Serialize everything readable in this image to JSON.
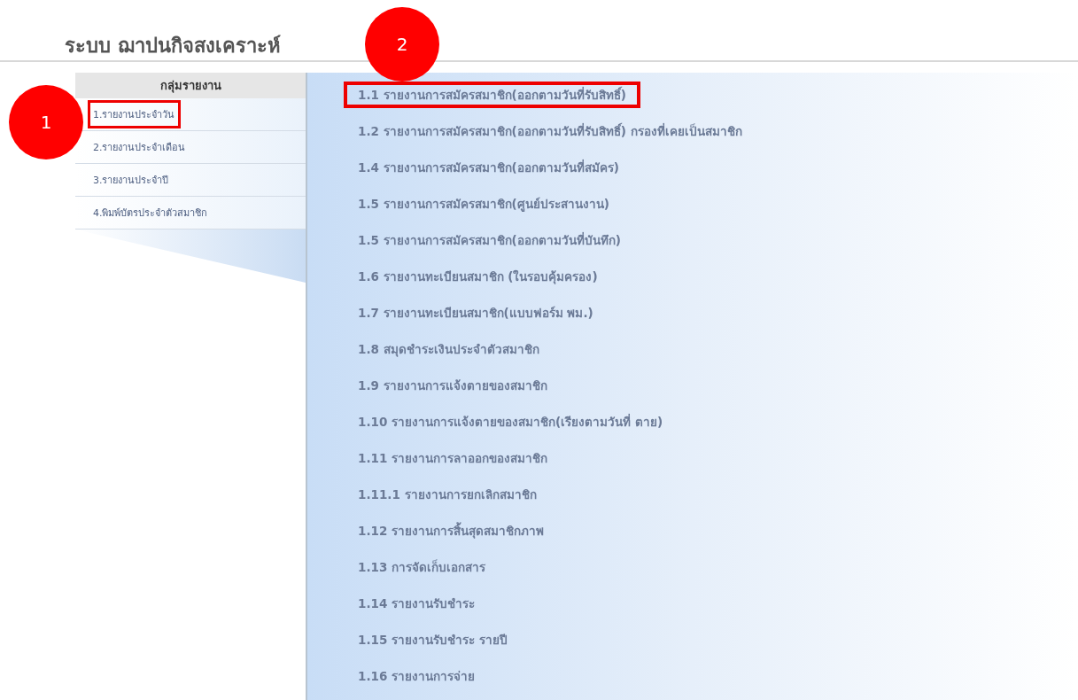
{
  "header": {
    "title": "ระบบ ฌาปนกิจสงเคราะห์"
  },
  "sidebar": {
    "heading": "กลุ่มรายงาน",
    "items": [
      {
        "label": "1.รายงานประจำวัน",
        "annotated": true
      },
      {
        "label": "2.รายงานประจำเดือน",
        "annotated": false
      },
      {
        "label": "3.รายงานประจำปี",
        "annotated": false
      },
      {
        "label": "4.พิมพ์บัตรประจำตัวสมาชิก",
        "annotated": false
      }
    ]
  },
  "reports": [
    {
      "label": "1.1 รายงานการสมัครสมาชิก(ออกตามวันที่รับสิทธิ์)",
      "annotated": true
    },
    {
      "label": "1.2 รายงานการสมัครสมาชิก(ออกตามวันที่รับสิทธิ์) กรองที่เคยเป็นสมาชิก",
      "annotated": false
    },
    {
      "label": "1.4 รายงานการสมัครสมาชิก(ออกตามวันที่สมัคร)",
      "annotated": false
    },
    {
      "label": "1.5 รายงานการสมัครสมาชิก(ศูนย์ประสานงาน)",
      "annotated": false
    },
    {
      "label": "1.5 รายงานการสมัครสมาชิก(ออกตามวันที่บันทึก)",
      "annotated": false
    },
    {
      "label": "1.6 รายงานทะเบียนสมาชิก (ในรอบคุ้มครอง)",
      "annotated": false
    },
    {
      "label": "1.7 รายงานทะเบียนสมาชิก(แบบฟอร์ม พม.)",
      "annotated": false
    },
    {
      "label": "1.8 สมุดชำระเงินประจำตัวสมาชิก",
      "annotated": false
    },
    {
      "label": "1.9 รายงานการแจ้งตายของสมาชิก",
      "annotated": false
    },
    {
      "label": "1.10 รายงานการแจ้งตายของสมาชิก(เรียงตามวันที่ ตาย)",
      "annotated": false
    },
    {
      "label": "1.11 รายงานการลาออกของสมาชิก",
      "annotated": false
    },
    {
      "label": "1.11.1 รายงานการยกเลิกสมาชิก",
      "annotated": false
    },
    {
      "label": "1.12 รายงานการสิ้นสุดสมาชิกภาพ",
      "annotated": false
    },
    {
      "label": "1.13 การจัดเก็บเอกสาร",
      "annotated": false
    },
    {
      "label": "1.14 รายงานรับชำระ",
      "annotated": false
    },
    {
      "label": "1.15 รายงานรับชำระ รายปี",
      "annotated": false
    },
    {
      "label": "1.16 รายงานการจ่าย",
      "annotated": false
    }
  ],
  "callouts": [
    {
      "label": "1",
      "kind": "sidebar"
    },
    {
      "label": "2",
      "kind": "reports"
    }
  ]
}
